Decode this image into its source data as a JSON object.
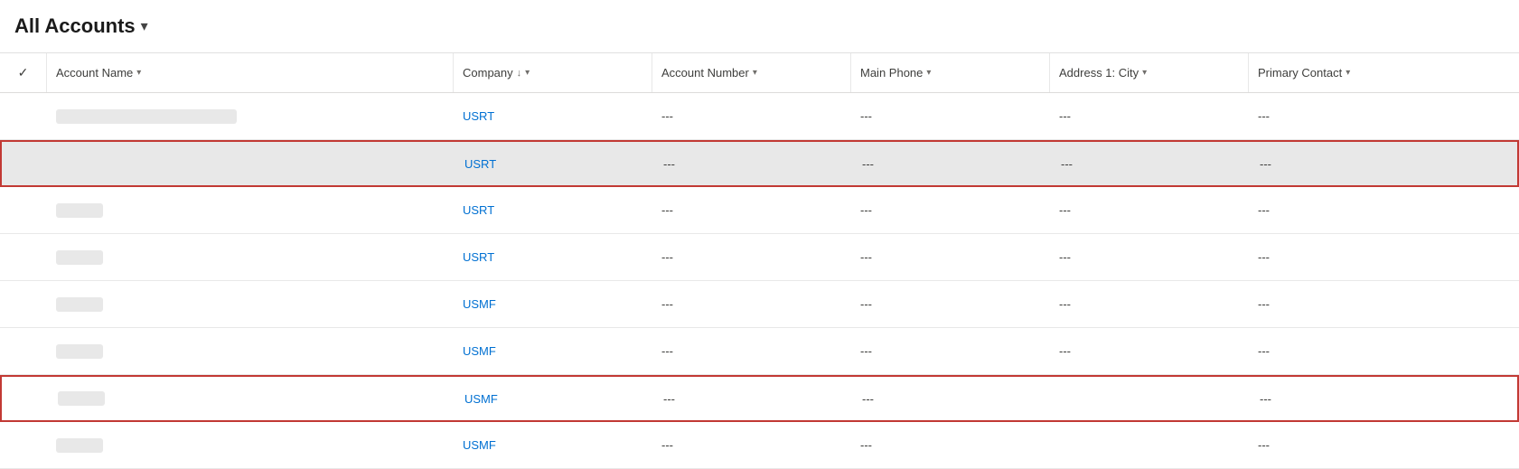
{
  "header": {
    "title": "All Accounts",
    "chevron": "▾"
  },
  "columns": {
    "check": "✓",
    "account_name": "Account Name",
    "company": "Company",
    "account_number": "Account Number",
    "main_phone": "Main Phone",
    "address_city": "Address 1: City",
    "primary_contact": "Primary Contact"
  },
  "rows": [
    {
      "id": 1,
      "account_name": "",
      "company": "USRT",
      "account_number": "---",
      "main_phone": "---",
      "address_city": "---",
      "primary_contact": "---",
      "style": "normal"
    },
    {
      "id": 2,
      "account_name": "",
      "company": "USRT",
      "account_number": "---",
      "main_phone": "---",
      "address_city": "---",
      "primary_contact": "---",
      "style": "highlighted"
    },
    {
      "id": 3,
      "account_name": "",
      "company": "USRT",
      "account_number": "---",
      "main_phone": "---",
      "address_city": "---",
      "primary_contact": "---",
      "style": "blurred"
    },
    {
      "id": 4,
      "account_name": "",
      "company": "USRT",
      "account_number": "---",
      "main_phone": "---",
      "address_city": "---",
      "primary_contact": "---",
      "style": "blurred"
    },
    {
      "id": 5,
      "account_name": "",
      "company": "USMF",
      "account_number": "---",
      "main_phone": "---",
      "address_city": "---",
      "primary_contact": "---",
      "style": "blurred"
    },
    {
      "id": 6,
      "account_name": "",
      "company": "USMF",
      "account_number": "---",
      "main_phone": "---",
      "address_city": "---",
      "primary_contact": "---",
      "style": "blurred"
    },
    {
      "id": 7,
      "account_name": "",
      "company": "USMF",
      "account_number": "---",
      "main_phone": "---",
      "address_city": "",
      "primary_contact": "---",
      "style": "red-bordered"
    },
    {
      "id": 8,
      "account_name": "",
      "company": "USMF",
      "account_number": "---",
      "main_phone": "---",
      "address_city": "",
      "primary_contact": "---",
      "style": "normal"
    }
  ],
  "empty": "---"
}
